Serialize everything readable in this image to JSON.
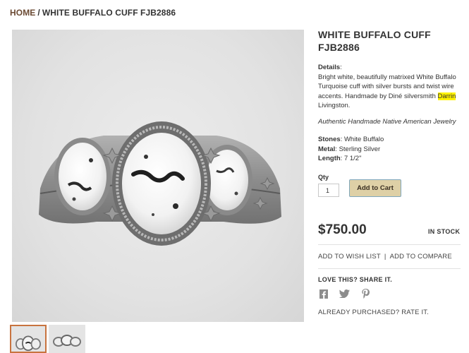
{
  "breadcrumb": {
    "home": "HOME",
    "separator": "/",
    "current": "WHITE BUFFALO CUFF FJB2886"
  },
  "product": {
    "title": "WHITE BUFFALO CUFF FJB2886",
    "details_label": "Details",
    "details_text_before": "Bright white, beautifully matrixed White Buffalo Turquoise cuff with silver bursts and twist wire accents. Handmade by Diné silversmith ",
    "details_highlighted": "Darrin",
    "details_text_after": " Livingston.",
    "tagline": "Authentic Handmade Native American Jewelry",
    "specs": [
      {
        "label": "Stones",
        "value": ": White Buffalo"
      },
      {
        "label": "Metal",
        "value": ": Sterling Silver"
      },
      {
        "label": "Length",
        "value": ": 7 1/2\""
      }
    ]
  },
  "purchase": {
    "qty_label": "Qty",
    "qty_value": "1",
    "add_to_cart": "Add to Cart",
    "price": "$750.00",
    "stock_status": "IN STOCK"
  },
  "actions": {
    "wishlist": "ADD TO WISH LIST",
    "separator": "|",
    "compare": "ADD TO COMPARE"
  },
  "share": {
    "title": "LOVE THIS? SHARE IT.",
    "icons": [
      "facebook-icon",
      "twitter-icon",
      "pinterest-icon"
    ]
  },
  "rate_link": "ALREADY PURCHASED? RATE IT.",
  "colors": {
    "accent_brown": "#6b4a33",
    "button_bg": "#ded0a6",
    "highlight": "#fff200",
    "thumb_active_border": "#c8733f"
  }
}
